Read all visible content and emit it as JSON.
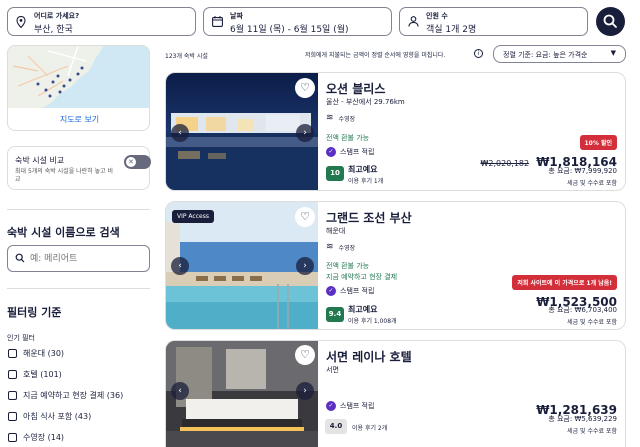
{
  "search": {
    "destination": {
      "label": "어디로 가세요?",
      "value": "부산, 한국"
    },
    "dates": {
      "label": "날짜",
      "value": "6월 11일 (목) - 6월 15일 (월)"
    },
    "travelers": {
      "label": "인원 수",
      "value": "객실 1개 2명"
    }
  },
  "sidebar": {
    "map_link": "지도로 보기",
    "compare": {
      "title": "숙박 시설 비교",
      "desc": "최대 5개의 숙박 시설을 나란히 놓고 비교"
    },
    "name_search": {
      "heading": "숙박 시설 이름으로 검색",
      "placeholder": "예: 메리어트"
    },
    "filter": {
      "heading": "필터링 기준",
      "group": "인기 필터",
      "items": [
        "해운대 (30)",
        "호텔 (101)",
        "지금 예약하고 현장 결제 (36)",
        "아침 식사 포함 (43)",
        "수영장 (14)"
      ]
    }
  },
  "results": {
    "count": "123개 숙박 시설",
    "notice": "저희에게 지불되는 금액이 정렬 순서에 영향을 미칩니다.",
    "sort": "정렬 기준: 요금: 높은 가격순"
  },
  "hotels": [
    {
      "name": "오션 블리스",
      "location": "울산 - 부산에서 29.76km",
      "amenity": "수영장",
      "refundable": "전액 환불 가능",
      "pay_later": "",
      "stamps": "스탬프 적립",
      "score": "10",
      "rating_label": "최고예요",
      "reviews": "이용 후기 1개",
      "badge": "10% 할인",
      "old_price": "₩2,020,182",
      "price": "₩1,818,164",
      "total": "총 요금: ₩7,999,920",
      "tax": "세금 및 수수료 포함"
    },
    {
      "vip": "VIP Access",
      "name": "그랜드 조선 부산",
      "location": "해운대",
      "amenity": "수영장",
      "refundable": "전액 환불 가능",
      "pay_later": "지금 예약하고 현장 결제",
      "stamps": "스탬프 적립",
      "score": "9.4",
      "rating_label": "최고예요",
      "reviews": "이용 후기 1,008개",
      "badge": "저희 사이트에 이 가격으로 1개 남음!",
      "price": "₩1,523,500",
      "total": "총 요금: ₩6,703,400",
      "tax": "세금 및 수수료 포함"
    },
    {
      "name": "서면 레이나 호텔",
      "location": "서면",
      "stamps": "스탬프 적립",
      "score": "4.0",
      "reviews": "이용 후기 2개",
      "price": "₩1,281,639",
      "total": "총 요금: ₩5,639,229",
      "tax": "세금 및 수수료 포함"
    }
  ],
  "colors": {
    "navy": "#191e3b",
    "link": "#1668e3",
    "green": "#227950",
    "red": "#d32f3b",
    "purple": "#5a2fc2"
  }
}
